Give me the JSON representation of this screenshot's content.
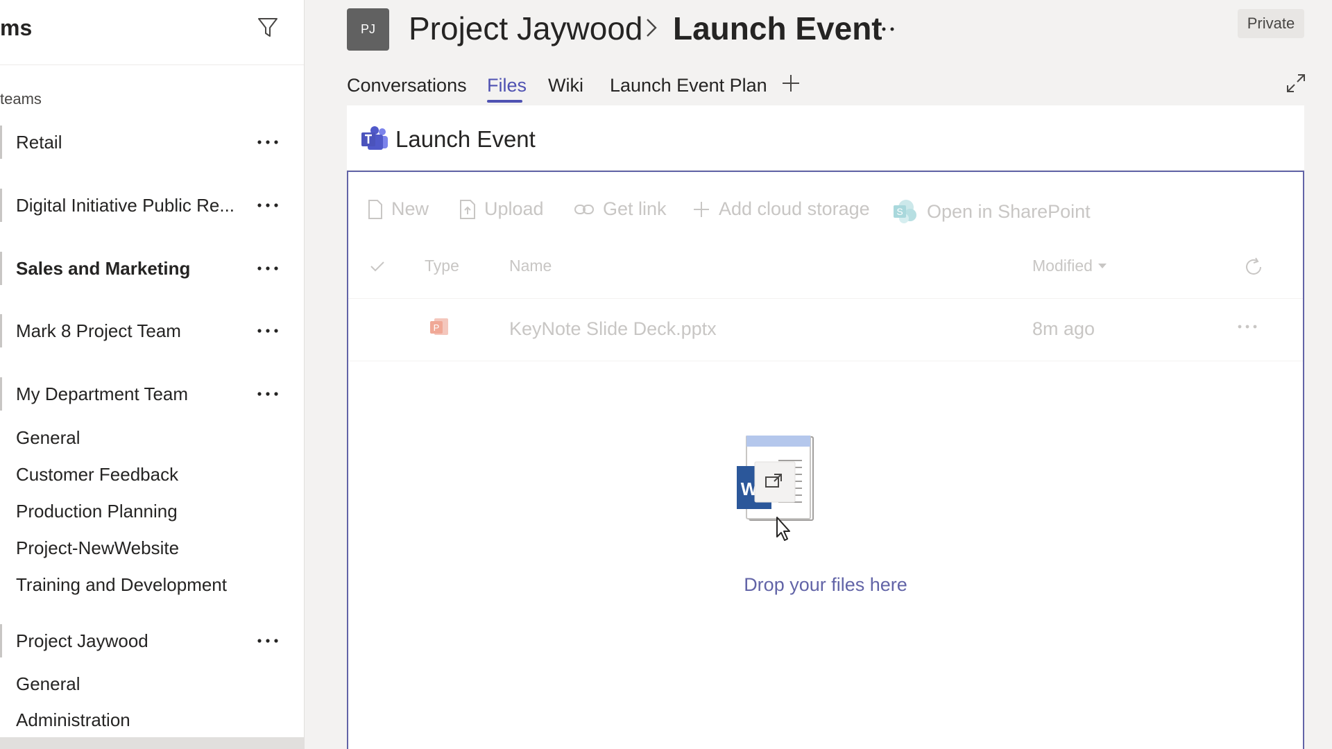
{
  "sidebar": {
    "title": "ms",
    "section_label": "teams",
    "teams": [
      {
        "name": "Retail",
        "active": false
      },
      {
        "name": "Digital Initiative Public Re...",
        "active": false
      },
      {
        "name": "Sales and Marketing",
        "active": true
      },
      {
        "name": "Mark 8 Project Team",
        "active": false
      },
      {
        "name": "My Department Team",
        "active": false,
        "channels": [
          "General",
          "Customer Feedback",
          "Production Planning",
          "Project-NewWebsite",
          "Training and Development"
        ]
      },
      {
        "name": "Project Jaywood",
        "active": false,
        "channels": [
          "General",
          "Administration"
        ]
      }
    ]
  },
  "header": {
    "avatar_initials": "PJ",
    "team_name": "Project Jaywood",
    "channel_name": "Launch Event",
    "privacy_badge": "Private"
  },
  "tabs": [
    {
      "label": "Conversations",
      "active": false
    },
    {
      "label": "Files",
      "active": true
    },
    {
      "label": "Wiki",
      "active": false
    },
    {
      "label": "Launch Event Plan",
      "active": false
    }
  ],
  "files_panel": {
    "title": "Launch Event",
    "commands": {
      "new": "New",
      "upload": "Upload",
      "get_link": "Get link",
      "add_cloud_storage": "Add cloud storage",
      "open_in_sharepoint": "Open in SharePoint"
    },
    "columns": {
      "type": "Type",
      "name": "Name",
      "modified": "Modified"
    },
    "files": [
      {
        "name": "KeyNote Slide Deck.pptx",
        "modified": "8m ago",
        "type_icon": "powerpoint-icon"
      }
    ],
    "drop_message": "Drop your files here"
  },
  "colors": {
    "accent": "#6264a7",
    "tab_active": "#4f52b2",
    "disabled_text": "#c8c6c4",
    "sidebar_bg": "#ffffff",
    "app_bg": "#f3f2f1"
  }
}
